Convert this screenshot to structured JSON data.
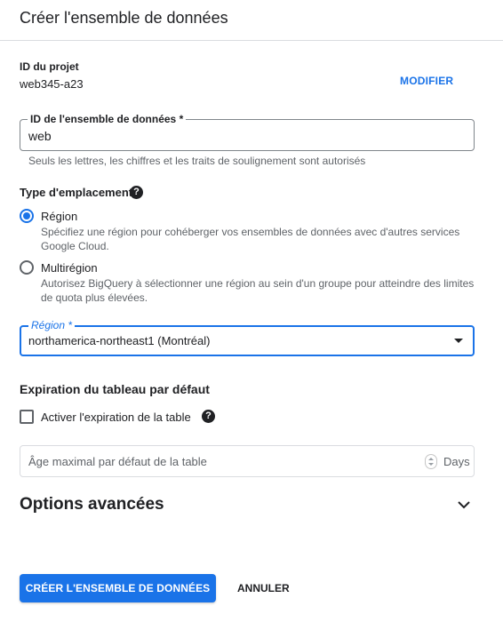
{
  "header": {
    "title": "Créer l'ensemble de données"
  },
  "project": {
    "label": "ID du projet",
    "value": "web345-a23",
    "modify_label": "MODIFIER"
  },
  "dataset_id": {
    "label": "ID de l'ensemble de données *",
    "value": "web",
    "hint": "Seuls les lettres, les chiffres et les traits de soulignement sont autorisés"
  },
  "location": {
    "title": "Type d'emplacement",
    "help_icon": "?",
    "options": [
      {
        "label": "Région",
        "checked": true,
        "description": "Spécifiez une région pour cohéberger vos ensembles de données avec d'autres services Google Cloud."
      },
      {
        "label": "Multirégion",
        "checked": false,
        "description": "Autorisez BigQuery à sélectionner une région au sein d'un groupe pour atteindre des limites de quota plus élevées."
      }
    ]
  },
  "region": {
    "label": "Région *",
    "value": "northamerica-northeast1 (Montréal)"
  },
  "expiration": {
    "title": "Expiration du tableau par défaut",
    "checkbox_label": "Activer l'expiration de la table",
    "checkbox_checked": false,
    "help_icon": "?",
    "age_placeholder": "Âge maximal par défaut de la table",
    "unit": "Days"
  },
  "advanced": {
    "title": "Options avancées",
    "icon": "chevron-down-icon"
  },
  "actions": {
    "create_label": "CRÉER L'ENSEMBLE DE DONNÉES",
    "cancel_label": "ANNULER"
  },
  "colors": {
    "accent": "#1a73e8",
    "text": "#202124",
    "secondary_text": "#5f6368",
    "border": "#80868b"
  }
}
